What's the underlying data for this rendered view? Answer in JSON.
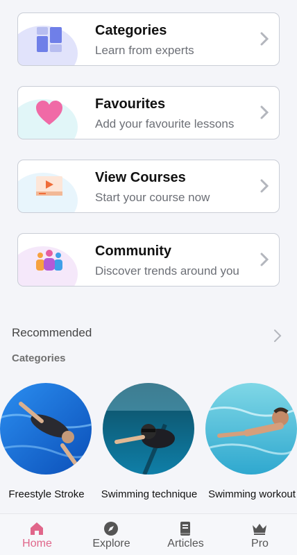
{
  "menu": [
    {
      "title": "Categories",
      "subtitle": "Learn from experts",
      "icon": "categories-grid-icon",
      "blob_color": "#c9ccf7"
    },
    {
      "title": "Favourites",
      "subtitle": "Add your favourite lessons",
      "icon": "heart-icon",
      "blob_color": "#c8eef2"
    },
    {
      "title": "View Courses",
      "subtitle": "Start your course now",
      "icon": "video-player-icon",
      "blob_color": "#d6ecf9"
    },
    {
      "title": "Community",
      "subtitle": "Discover trends around you",
      "icon": "people-group-icon",
      "blob_color": "#ecd6f5"
    }
  ],
  "recommended": {
    "title": "Recommended",
    "subtitle": "Categories",
    "items": [
      {
        "label": "Freestyle Stroke"
      },
      {
        "label": "Swimming technique"
      },
      {
        "label": "Swimming workout"
      }
    ]
  },
  "tabs": [
    {
      "label": "Home",
      "icon": "home-icon",
      "active": true
    },
    {
      "label": "Explore",
      "icon": "compass-icon",
      "active": false
    },
    {
      "label": "Articles",
      "icon": "book-icon",
      "active": false
    },
    {
      "label": "Pro",
      "icon": "crown-icon",
      "active": false
    }
  ],
  "colors": {
    "accent": "#e0668a",
    "card_border": "#c9cdd6",
    "background": "#f4f5f9"
  }
}
